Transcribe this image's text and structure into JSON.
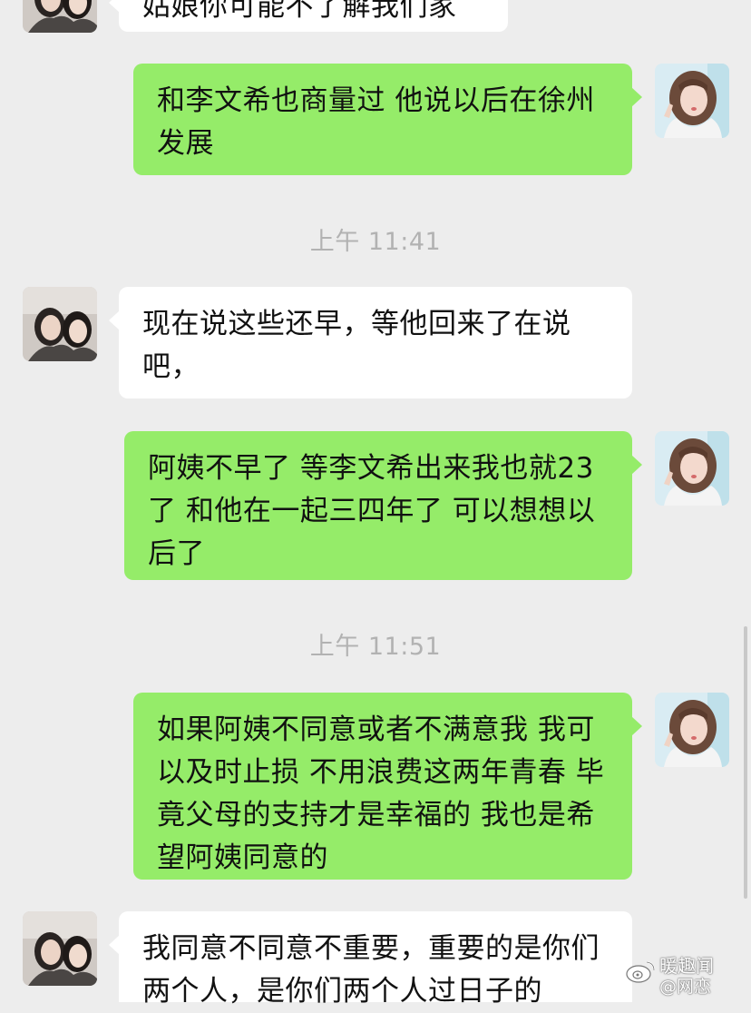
{
  "messages": [
    {
      "side": "left",
      "text": "姑娘你可能不了解我们家"
    },
    {
      "side": "right",
      "text": "和李文希也商量过  他说以后在徐州发展"
    },
    {
      "side": "left",
      "text": "现在说这些还早，等他回来了在说吧，"
    },
    {
      "side": "right",
      "text": "阿姨不早了 等李文希出来我也就23了 和他在一起三四年了 可以想想以后了"
    },
    {
      "side": "right",
      "text": "如果阿姨不同意或者不满意我 我可以及时止损  不用浪费这两年青春 毕竟父母的支持才是幸福的 我也是希望阿姨同意的"
    },
    {
      "side": "left",
      "text": "我同意不同意不重要，重要的是你们两个人，是你们两个人过日子的"
    }
  ],
  "timestamps": [
    "上午 11:41",
    "上午 11:51"
  ],
  "watermark": {
    "line1": "暖趣闻",
    "line2": "@网恋"
  },
  "colors": {
    "background": "#ededed",
    "bubble_self": "#95ec69",
    "bubble_other": "#ffffff",
    "timestamp": "#b2b2b2"
  },
  "icons": {
    "watermark_logo": "weibo-logo-icon"
  }
}
